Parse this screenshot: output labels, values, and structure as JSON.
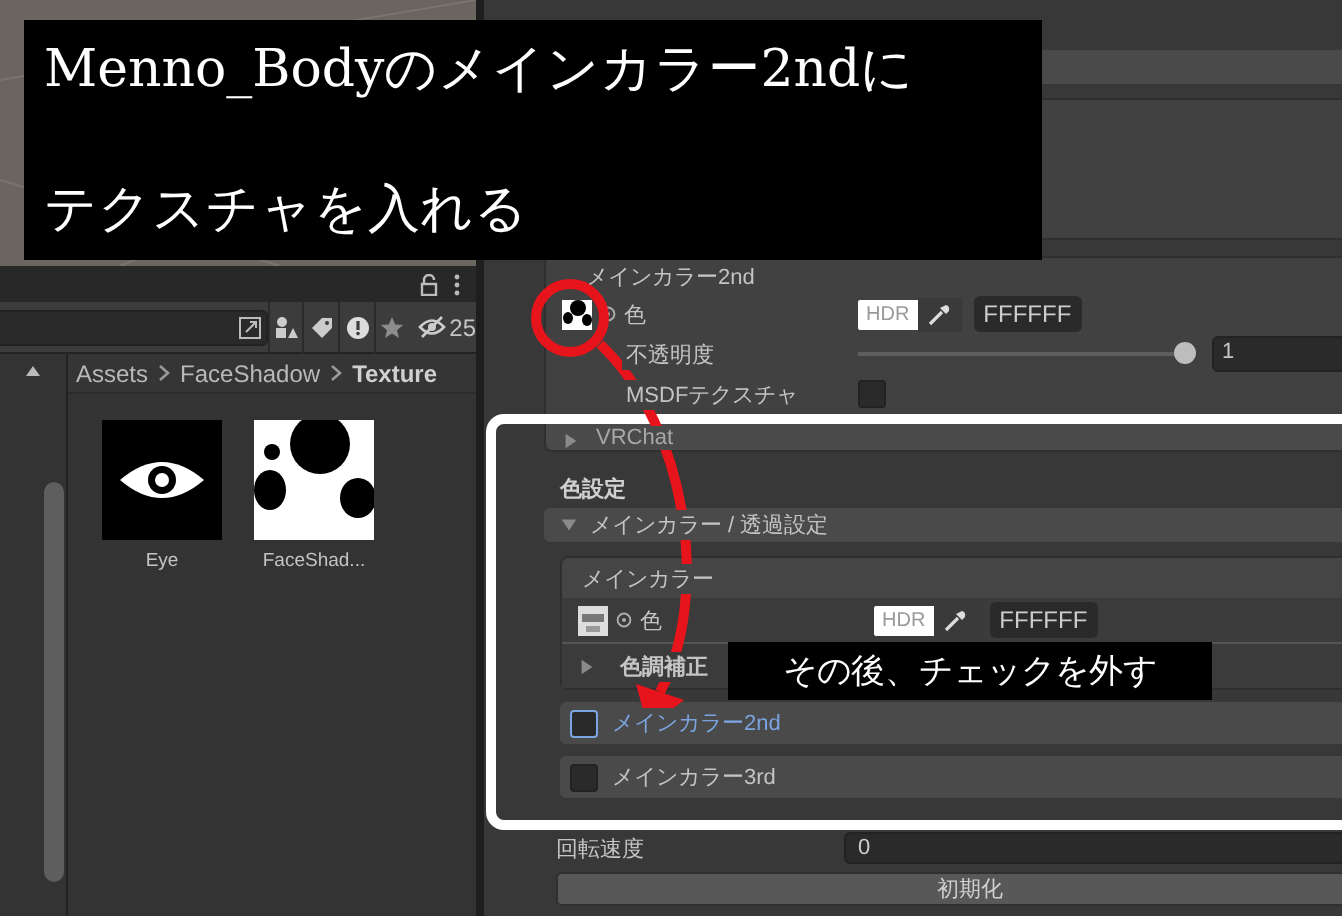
{
  "caption_top": {
    "lines": [
      "Menno_Bodyのメインカラー2ndに",
      "テクスチャを入れる"
    ]
  },
  "project": {
    "hidden_count": "25",
    "breadcrumb": [
      {
        "label": "Assets",
        "current": false
      },
      {
        "label": "FaceShadow",
        "current": false
      },
      {
        "label": "Texture",
        "current": true
      }
    ],
    "assets": [
      {
        "name": "Eye",
        "kind": "eye"
      },
      {
        "name": "FaceShad...",
        "kind": "blobs"
      }
    ]
  },
  "inspector": {
    "main_color_2nd": {
      "title": "メインカラー2nd",
      "color_label": "色",
      "hdr": "HDR",
      "hex": "FFFFFF",
      "opacity_label": "不透明度",
      "opacity": {
        "level": 1
      },
      "opacity_value": "1",
      "msdf_label": "MSDFテクスチャ",
      "msdf_checked": false
    },
    "vrchat": {
      "label": "VRChat",
      "expanded": false
    },
    "color_settings": {
      "heading": "色設定",
      "foldout": {
        "label": "メインカラー / 透過設定",
        "expanded": true
      },
      "main_color": {
        "title": "メインカラー",
        "color_label": "色",
        "hdr": "HDR",
        "hex": "FFFFFF",
        "tone": {
          "label": "色調補正",
          "expanded": false
        }
      },
      "layers": [
        {
          "label": "メインカラー2nd",
          "checked": false,
          "selected": true
        },
        {
          "label": "メインカラー3rd",
          "checked": false,
          "selected": false
        }
      ]
    },
    "rotation_label": "回転速度",
    "rotation_value": "0",
    "reset_button": "初期化"
  },
  "caption_bottom": "その後、チェックを外す"
}
